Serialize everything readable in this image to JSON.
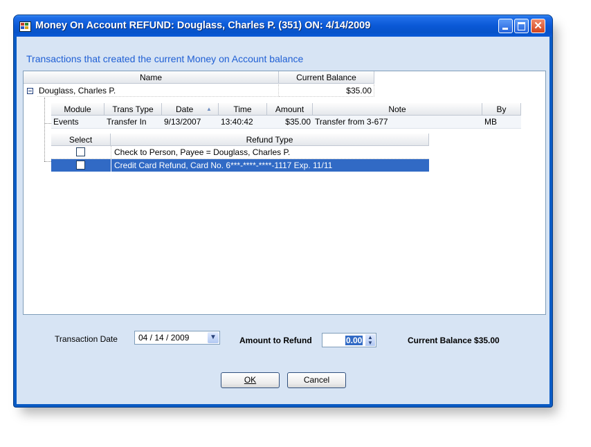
{
  "window": {
    "title": "Money On Account REFUND: Douglass, Charles P. (351) ON: 4/14/2009"
  },
  "heading": "Transactions that created the current Money on Account balance",
  "grid": {
    "columns": {
      "name": "Name",
      "balance": "Current Balance"
    },
    "account": {
      "name": "Douglass, Charles P.",
      "balance": "$35.00"
    },
    "trans_columns": [
      "Module",
      "Trans Type",
      "Date",
      "Time",
      "Amount",
      "Note",
      "By"
    ],
    "transaction": [
      "Events",
      "Transfer In",
      "9/13/2007",
      "13:40:42",
      "$35.00",
      "Transfer from 3-677",
      "MB"
    ],
    "refund_columns": {
      "select": "Select",
      "type": "Refund Type"
    },
    "refund_rows": [
      {
        "type": "Check to Person, Payee = Douglass, Charles P.",
        "selected": false
      },
      {
        "type": "Credit Card Refund, Card No. 6***-****-****-1117 Exp. 11/11",
        "selected": true
      }
    ]
  },
  "form": {
    "transaction_date_label": "Transaction Date",
    "transaction_date_value": "04 / 14 / 2009",
    "amount_label": "Amount to Refund",
    "amount_value": "0.00",
    "current_balance": "Current Balance $35.00"
  },
  "buttons": {
    "ok": "OK",
    "cancel": "Cancel"
  },
  "colors": {
    "selected_row": "#316ac5",
    "heading": "#1f5fd4",
    "title_bar": "#0a58d6"
  }
}
